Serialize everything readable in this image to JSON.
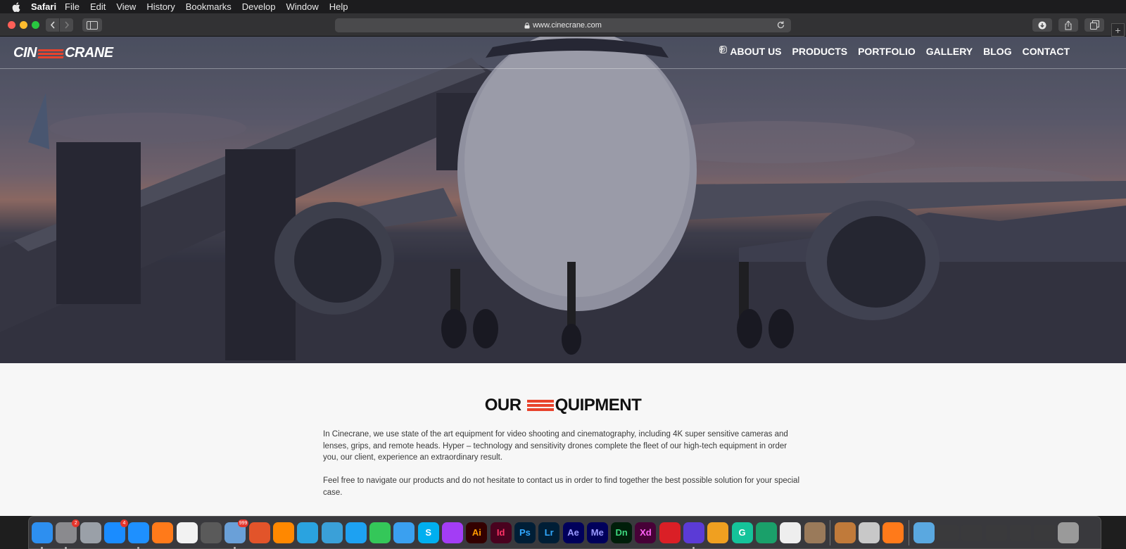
{
  "menubar": {
    "app_name": "Safari",
    "items": [
      "File",
      "Edit",
      "View",
      "History",
      "Bookmarks",
      "Develop",
      "Window",
      "Help"
    ]
  },
  "browser": {
    "url": "www.cinecrane.com"
  },
  "site": {
    "logo_left": "CIN",
    "logo_right": "CRANE",
    "nav": [
      "ABOUT US",
      "PRODUCTS",
      "PORTFOLIO",
      "GALLERY",
      "BLOG",
      "CONTACT"
    ],
    "social": [
      "facebook-icon",
      "instagram-icon"
    ]
  },
  "equipment": {
    "heading_left": "OUR",
    "heading_right": "QUIPMENT",
    "paragraph1": "In Cinecrane, we use state of the art equipment for video shooting and cinematography, including 4K super sensitive cameras and lenses, grips, and remote heads. Hyper – technology and sensitivity drones complete the fleet of our high-tech equipment in order you, our client, experience an extraordinary result.",
    "paragraph2": "Feel free to navigate our products and do not hesitate to contact us in order to find together the best possible solution for your special case."
  },
  "dock": {
    "apps": [
      {
        "name": "finder",
        "label": "",
        "color": "#2d8ff0"
      },
      {
        "name": "system-preferences",
        "label": "",
        "color": "#8a8a8e",
        "badge": "2"
      },
      {
        "name": "launchpad",
        "label": "",
        "color": "#9aa0a8"
      },
      {
        "name": "app-store",
        "label": "",
        "color": "#1a8cff",
        "badge": "4"
      },
      {
        "name": "safari",
        "label": "",
        "color": "#1e90ff"
      },
      {
        "name": "firefox",
        "label": "",
        "color": "#ff7a1a"
      },
      {
        "name": "clock",
        "label": "",
        "color": "#f2f2f2"
      },
      {
        "name": "bouquet",
        "label": "",
        "color": "#5a5a5a"
      },
      {
        "name": "preview",
        "label": "",
        "color": "#6aa0d8",
        "badge": "999"
      },
      {
        "name": "rocket-typist",
        "label": "",
        "color": "#e2542a"
      },
      {
        "name": "vlc",
        "label": "",
        "color": "#ff8800"
      },
      {
        "name": "telegram",
        "label": "",
        "color": "#2aa3e0"
      },
      {
        "name": "cyberduck",
        "label": "",
        "color": "#3aa0d8"
      },
      {
        "name": "twitter",
        "label": "",
        "color": "#1da1f2"
      },
      {
        "name": "facetime",
        "label": "",
        "color": "#34c759"
      },
      {
        "name": "messages",
        "label": "",
        "color": "#3aa0f0"
      },
      {
        "name": "skype",
        "label": "S",
        "color": "#00aff0"
      },
      {
        "name": "messenger",
        "label": "",
        "color": "#a33df5"
      },
      {
        "name": "illustrator",
        "label": "Ai",
        "color": "#330000",
        "fg": "#ff9a00"
      },
      {
        "name": "indesign",
        "label": "Id",
        "color": "#49021f",
        "fg": "#ff3366"
      },
      {
        "name": "photoshop",
        "label": "Ps",
        "color": "#001e36",
        "fg": "#31a8ff"
      },
      {
        "name": "lightroom",
        "label": "Lr",
        "color": "#001e36",
        "fg": "#31a8ff"
      },
      {
        "name": "after-effects",
        "label": "Ae",
        "color": "#00005b",
        "fg": "#9999ff"
      },
      {
        "name": "media-encoder",
        "label": "Me",
        "color": "#00005b",
        "fg": "#9999ff"
      },
      {
        "name": "dimension",
        "label": "Dn",
        "color": "#001e0a",
        "fg": "#3dd67d"
      },
      {
        "name": "xd",
        "label": "Xd",
        "color": "#470137",
        "fg": "#ff61f6"
      },
      {
        "name": "creative-cloud",
        "label": "",
        "color": "#da1f26"
      },
      {
        "name": "proton-vpn",
        "label": "",
        "color": "#5b3bd6"
      },
      {
        "name": "vectornator",
        "label": "",
        "color": "#f0a020"
      },
      {
        "name": "grammarly",
        "label": "G",
        "color": "#15c39a"
      },
      {
        "name": "grammarly-2",
        "label": "",
        "color": "#1aa06a"
      },
      {
        "name": "textedit",
        "label": "",
        "color": "#eeeeee"
      },
      {
        "name": "garageband",
        "label": "",
        "color": "#9a7a5a"
      },
      {
        "name": "cocktail",
        "label": "",
        "color": "#c07a3a"
      },
      {
        "name": "calculator",
        "label": "",
        "color": "#c8c8c8"
      },
      {
        "name": "firefox-2",
        "label": "",
        "color": "#ff7a1a"
      },
      {
        "name": "downloads-folder",
        "label": "",
        "color": "#5aa8e0"
      },
      {
        "name": "stack-1",
        "label": "",
        "color": "#3a3a3c"
      },
      {
        "name": "stack-2",
        "label": "",
        "color": "#3a3a3c"
      },
      {
        "name": "stack-3",
        "label": "",
        "color": "#3a3a3c"
      },
      {
        "name": "stack-4",
        "label": "",
        "color": "#3a3a3c"
      },
      {
        "name": "stack-5",
        "label": "",
        "color": "#3a3a3c"
      },
      {
        "name": "trash",
        "label": "",
        "color": "#9a9a9a"
      }
    ]
  }
}
